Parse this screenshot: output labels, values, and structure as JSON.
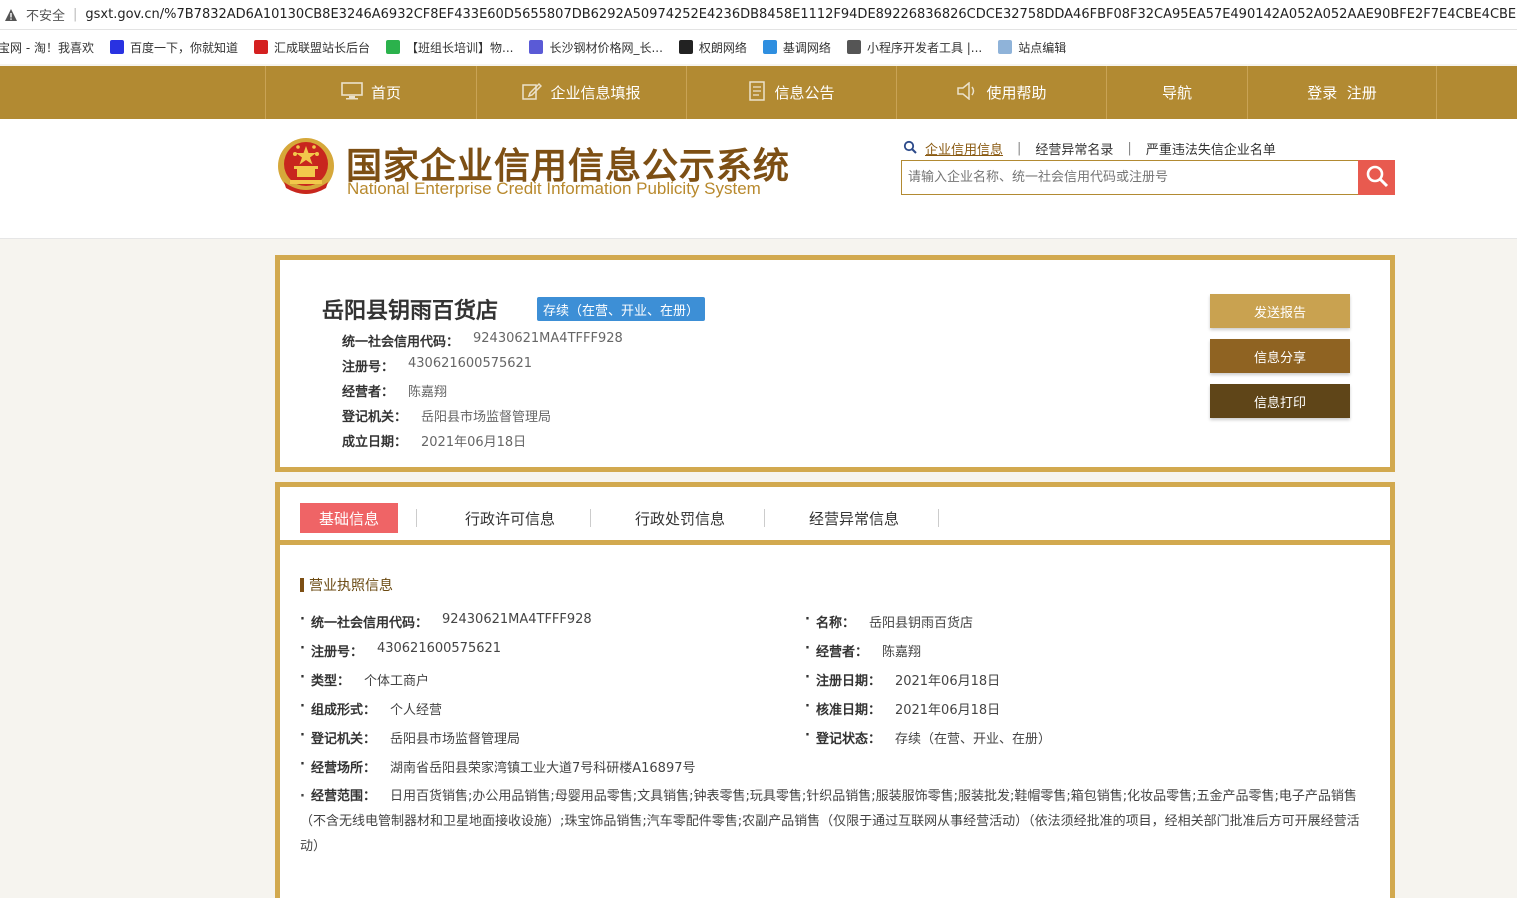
{
  "browser": {
    "insecure_label": "不安全",
    "separator": "|",
    "url": "gsxt.gov.cn/%7B7832AD6A10130CB8E3246A6932CF8EF433E60D5655807DB6292A50974252E4236DB8458E1112F94DE89226836826CDCE32758DDA46FBF08F32CA95EA57E490142A052A052AAE90BFE2F7E4CBE4CBE",
    "bookmarks": [
      {
        "label": "宝网 - 淘！我喜欢",
        "icon": "taobao-icon",
        "color": "#ff5000"
      },
      {
        "label": "百度一下，你就知道",
        "icon": "baidu-paw-icon",
        "color": "#2932e1"
      },
      {
        "label": "汇成联盟站长后台",
        "icon": "red-square-icon",
        "color": "#d42020"
      },
      {
        "label": "【班组长培训】物...",
        "icon": "play-icon",
        "color": "#2bb24c"
      },
      {
        "label": "长沙钢材价格网_长...",
        "icon": "site-icon",
        "color": "#5a5ad6"
      },
      {
        "label": "权朗网络",
        "icon": "c-logo-icon",
        "color": "#222222"
      },
      {
        "label": "基调网络",
        "icon": "cloud-icon",
        "color": "#2f8fe0"
      },
      {
        "label": "小程序开发者工具 |...",
        "icon": "globe-icon",
        "color": "#555555"
      },
      {
        "label": "站点编辑",
        "icon": "cloud-edit-icon",
        "color": "#8fb3d9"
      }
    ]
  },
  "nav": {
    "items": [
      {
        "label": "首页",
        "icon": "monitor-icon"
      },
      {
        "label": "企业信息填报",
        "icon": "edit-icon"
      },
      {
        "label": "信息公告",
        "icon": "document-icon"
      },
      {
        "label": "使用帮助",
        "icon": "speaker-icon"
      },
      {
        "label": "导航",
        "icon": ""
      },
      {
        "label": "登录  注册",
        "icon": ""
      }
    ]
  },
  "header": {
    "title": "国家企业信用信息公示系统",
    "subtitle": "National Enterprise Credit Information Publicity System",
    "search_tabs": [
      "企业信用信息",
      "经营异常名录",
      "严重违法失信企业名单"
    ],
    "search_tab_separator": "|",
    "search_placeholder": "请输入企业名称、统一社会信用代码或注册号"
  },
  "company": {
    "name": "岳阳县钥雨百货店",
    "status_badge": "存续（在营、开业、在册）",
    "fields": [
      {
        "label": "统一社会信用代码：",
        "value": "92430621MA4TFFF928"
      },
      {
        "label": "注册号：",
        "value": "430621600575621"
      },
      {
        "label": "经营者：",
        "value": "陈嘉翔"
      },
      {
        "label": "登记机关：",
        "value": "岳阳县市场监督管理局"
      },
      {
        "label": "成立日期：",
        "value": "2021年06月18日"
      }
    ],
    "actions": [
      {
        "label": "发送报告",
        "color": "#c9a250"
      },
      {
        "label": "信息分享",
        "color": "#8f6322"
      },
      {
        "label": "信息打印",
        "color": "#5f4518"
      }
    ]
  },
  "tabs": [
    {
      "label": "基础信息",
      "active": true
    },
    {
      "label": "行政许可信息",
      "active": false
    },
    {
      "label": "行政处罚信息",
      "active": false
    },
    {
      "label": "经营异常信息",
      "active": false
    }
  ],
  "license": {
    "section_title": "营业执照信息",
    "bullet": "·",
    "left": [
      {
        "label": "统一社会信用代码：",
        "value": "92430621MA4TFFF928"
      },
      {
        "label": "注册号：",
        "value": "430621600575621"
      },
      {
        "label": "类型：",
        "value": "个体工商户"
      },
      {
        "label": "组成形式：",
        "value": "个人经营"
      },
      {
        "label": "登记机关：",
        "value": "岳阳县市场监督管理局"
      },
      {
        "label": "经营场所：",
        "value": "湖南省岳阳县荣家湾镇工业大道7号科研楼A16897号"
      }
    ],
    "right": [
      {
        "label": "名称：",
        "value": "岳阳县钥雨百货店"
      },
      {
        "label": "经营者：",
        "value": "陈嘉翔"
      },
      {
        "label": "注册日期：",
        "value": "2021年06月18日"
      },
      {
        "label": "核准日期：",
        "value": "2021年06月18日"
      },
      {
        "label": "登记状态：",
        "value": "存续（在营、开业、在册）"
      }
    ],
    "scope_label": "经营范围：",
    "scope_value": "日用百货销售;办公用品销售;母婴用品零售;文具销售;钟表零售;玩具零售;针织品销售;服装服饰零售;服装批发;鞋帽零售;箱包销售;化妆品零售;五金产品零售;电子产品销售（不含无线电管制器材和卫星地面接收设施）;珠宝饰品销售;汽车零配件零售;农副产品销售（仅限于通过互联网从事经营活动）（依法须经批准的项目，经相关部门批准后方可开展经营活动）"
  }
}
